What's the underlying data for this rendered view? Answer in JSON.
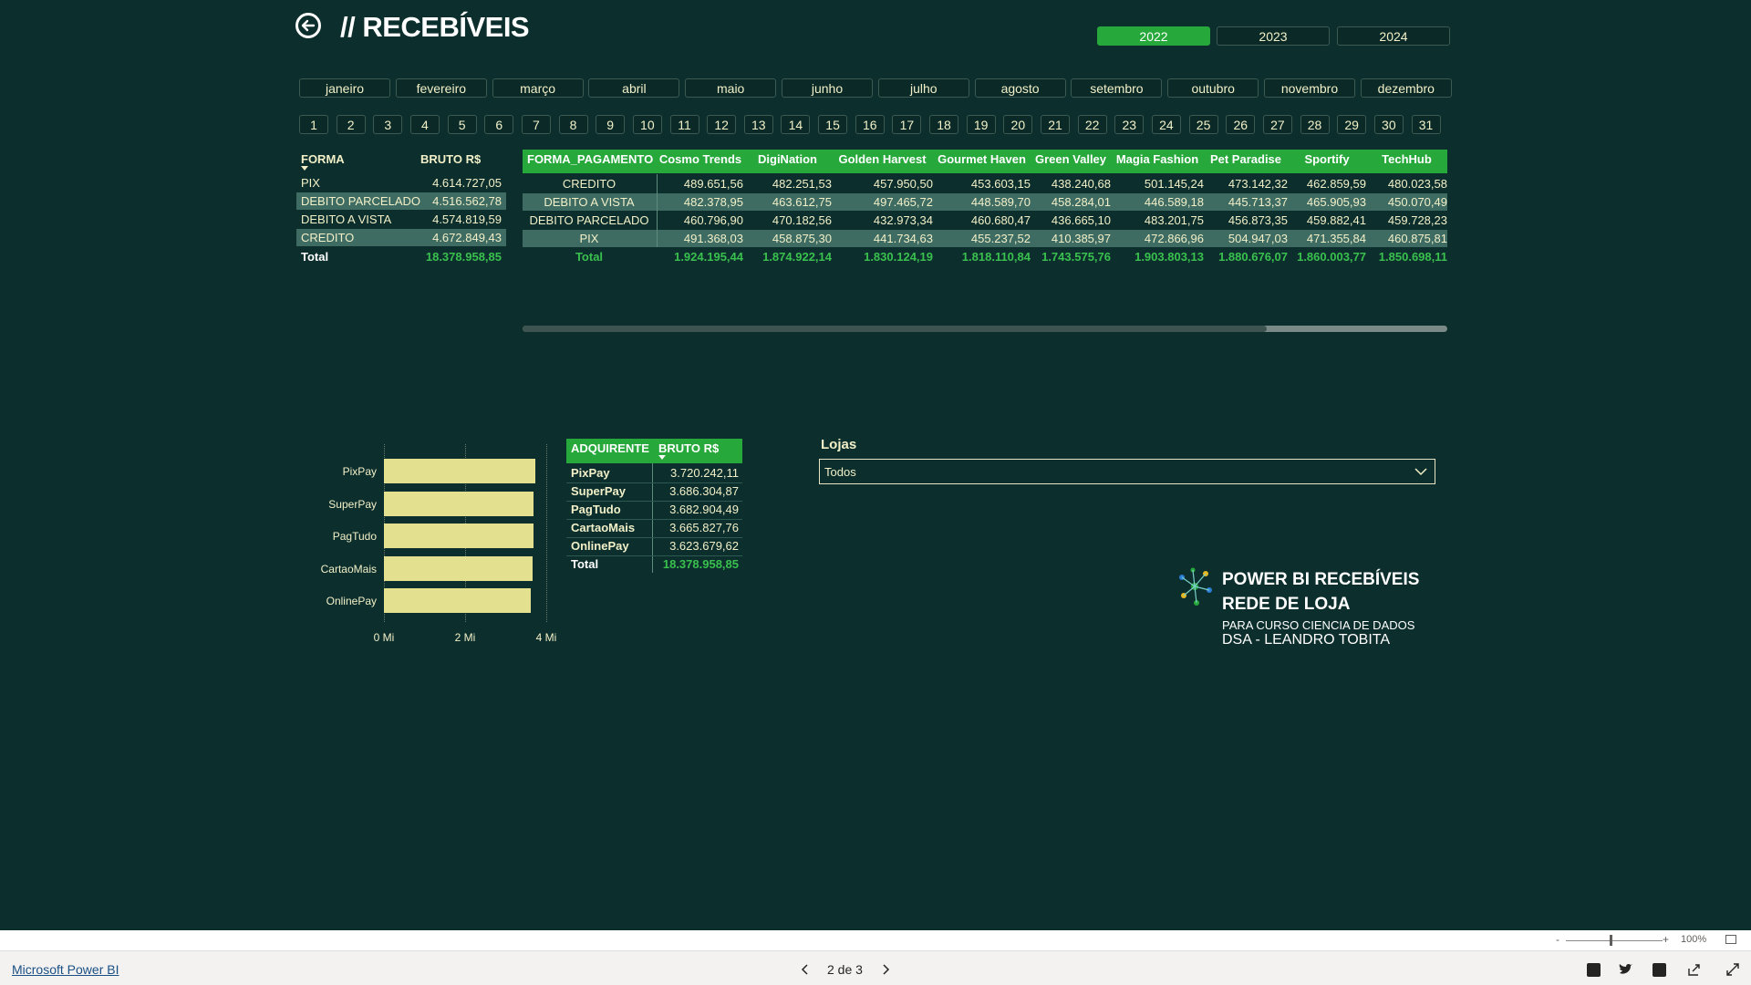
{
  "header": {
    "title": "// RECEBÍVEIS",
    "back_icon": "back-arrow-circle-icon"
  },
  "years": [
    "2022",
    "2023",
    "2024"
  ],
  "selected_year": "2022",
  "months": [
    "janeiro",
    "fevereiro",
    "março",
    "abril",
    "maio",
    "junho",
    "julho",
    "agosto",
    "setembro",
    "outubro",
    "novembro",
    "dezembro"
  ],
  "days": [
    "1",
    "2",
    "3",
    "4",
    "5",
    "6",
    "7",
    "8",
    "9",
    "10",
    "11",
    "12",
    "13",
    "14",
    "15",
    "16",
    "17",
    "18",
    "19",
    "20",
    "21",
    "22",
    "23",
    "24",
    "25",
    "26",
    "27",
    "28",
    "29",
    "30",
    "31"
  ],
  "forma_table": {
    "headers": [
      "FORMA",
      "BRUTO R$"
    ],
    "rows": [
      [
        "PIX",
        "4.614.727,05"
      ],
      [
        "DEBITO PARCELADO",
        "4.516.562,78"
      ],
      [
        "DEBITO A VISTA",
        "4.574.819,59"
      ],
      [
        "CREDITO",
        "4.672.849,43"
      ]
    ],
    "total": [
      "Total",
      "18.378.958,85"
    ]
  },
  "matrix": {
    "headers": [
      "FORMA_PAGAMENTO",
      "Cosmo Trends",
      "DigiNation",
      "Golden Harvest",
      "Gourmet Haven",
      "Green Valley",
      "Magia Fashion",
      "Pet Paradise",
      "Sportify",
      "TechHub"
    ],
    "rows": [
      [
        "CREDITO",
        "489.651,56",
        "482.251,53",
        "457.950,50",
        "453.603,15",
        "438.240,68",
        "501.145,24",
        "473.142,32",
        "462.859,59",
        "480.023,58"
      ],
      [
        "DEBITO A VISTA",
        "482.378,95",
        "463.612,75",
        "497.465,72",
        "448.589,70",
        "458.284,01",
        "446.589,18",
        "445.713,37",
        "465.905,93",
        "450.070,49"
      ],
      [
        "DEBITO PARCELADO",
        "460.796,90",
        "470.182,56",
        "432.973,34",
        "460.680,47",
        "436.665,10",
        "483.201,75",
        "456.873,35",
        "459.882,41",
        "459.728,23"
      ],
      [
        "PIX",
        "491.368,03",
        "458.875,30",
        "441.734,63",
        "455.237,52",
        "410.385,97",
        "472.866,96",
        "504.947,03",
        "471.355,84",
        "460.875,81"
      ]
    ],
    "total": [
      "Total",
      "1.924.195,44",
      "1.874.922,14",
      "1.830.124,19",
      "1.818.110,84",
      "1.743.575,76",
      "1.903.803,13",
      "1.880.676,07",
      "1.860.003,77",
      "1.850.698,11"
    ]
  },
  "chart_data": {
    "type": "bar",
    "orientation": "horizontal",
    "categories": [
      "PixPay",
      "SuperPay",
      "PagTudo",
      "CartaoMais",
      "OnlinePay"
    ],
    "values": [
      3720242.11,
      3686304.87,
      3682904.49,
      3665827.76,
      3623679.62
    ],
    "xlim": [
      0,
      4000000
    ],
    "x_ticks": [
      "0 Mi",
      "2 Mi",
      "4 Mi"
    ],
    "x_tick_values": [
      0,
      2000000,
      4000000
    ],
    "bar_color": "#e3e08f",
    "grid": true
  },
  "acquirer_table": {
    "headers": [
      "ADQUIRENTE",
      "BRUTO R$"
    ],
    "rows": [
      [
        "PixPay",
        "3.720.242,11"
      ],
      [
        "SuperPay",
        "3.686.304,87"
      ],
      [
        "PagTudo",
        "3.682.904,49"
      ],
      [
        "CartaoMais",
        "3.665.827,76"
      ],
      [
        "OnlinePay",
        "3.623.679,62"
      ]
    ],
    "total": [
      "Total",
      "18.378.958,85"
    ]
  },
  "lojas": {
    "label": "Lojas",
    "value": "Todos"
  },
  "logo": {
    "line1": "POWER BI RECEBÍVEIS",
    "line2": "REDE DE LOJA",
    "line3": "PARA CURSO CIENCIA DE DADOS",
    "line4": "DSA - LEANDRO TOBITA"
  },
  "footer": {
    "link": "Microsoft Power BI",
    "page_indicator": "2 de 3",
    "zoom": "100%"
  },
  "colors": {
    "background": "#0c2e2c",
    "accent": "#27a83b",
    "text": "#f2f0c8",
    "total": "#3ac04e"
  }
}
